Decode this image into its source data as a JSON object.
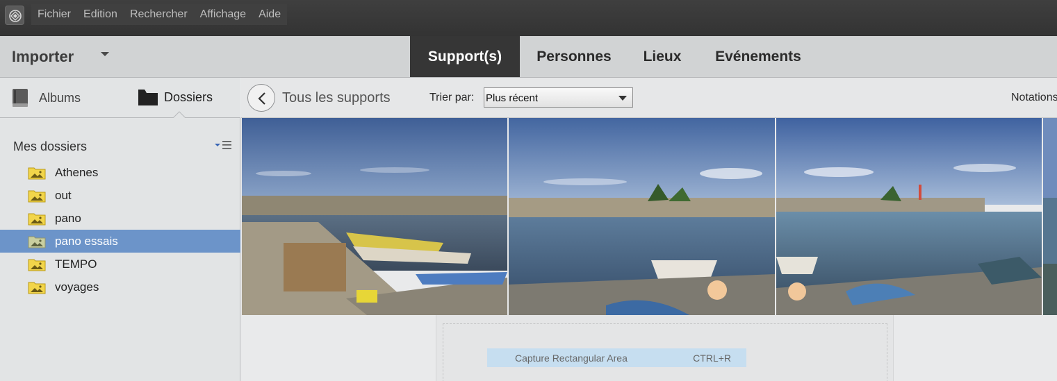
{
  "menubar": {
    "items": [
      "Fichier",
      "Edition",
      "Rechercher",
      "Affichage",
      "Aide"
    ]
  },
  "header": {
    "import_label": "Importer",
    "tabs": [
      {
        "label": "Support(s)",
        "active": true
      },
      {
        "label": "Personnes",
        "active": false
      },
      {
        "label": "Lieux",
        "active": false
      },
      {
        "label": "Evénements",
        "active": false
      }
    ]
  },
  "left_panel": {
    "albums_label": "Albums",
    "folders_label": "Dossiers",
    "my_folders_title": "Mes dossiers",
    "folders": [
      {
        "name": "Athenes",
        "selected": false
      },
      {
        "name": "out",
        "selected": false
      },
      {
        "name": "pano",
        "selected": false
      },
      {
        "name": "pano essais",
        "selected": true
      },
      {
        "name": "TEMPO",
        "selected": false
      },
      {
        "name": "voyages",
        "selected": false
      }
    ]
  },
  "toolbar": {
    "back_icon": "chevron-left-icon",
    "all_media_label": "Tous les supports",
    "sort_label": "Trier par:",
    "sort_value": "Plus récent",
    "ratings_label": "Notations"
  },
  "photos": [
    "harbor-boats-photo-1",
    "harbor-boats-photo-2",
    "harbor-boats-photo-3",
    "harbor-boats-photo-4"
  ],
  "capture_menu": {
    "item_label": "Capture Rectangular Area",
    "item_shortcut": "CTRL+R"
  },
  "colors": {
    "menubar_bg": "#3a3a3a",
    "active_tab_bg": "#363636",
    "selected_folder_bg": "#6c94c9",
    "folder_icon_yellow": "#f2d54a",
    "capture_highlight": "#c6def0"
  }
}
